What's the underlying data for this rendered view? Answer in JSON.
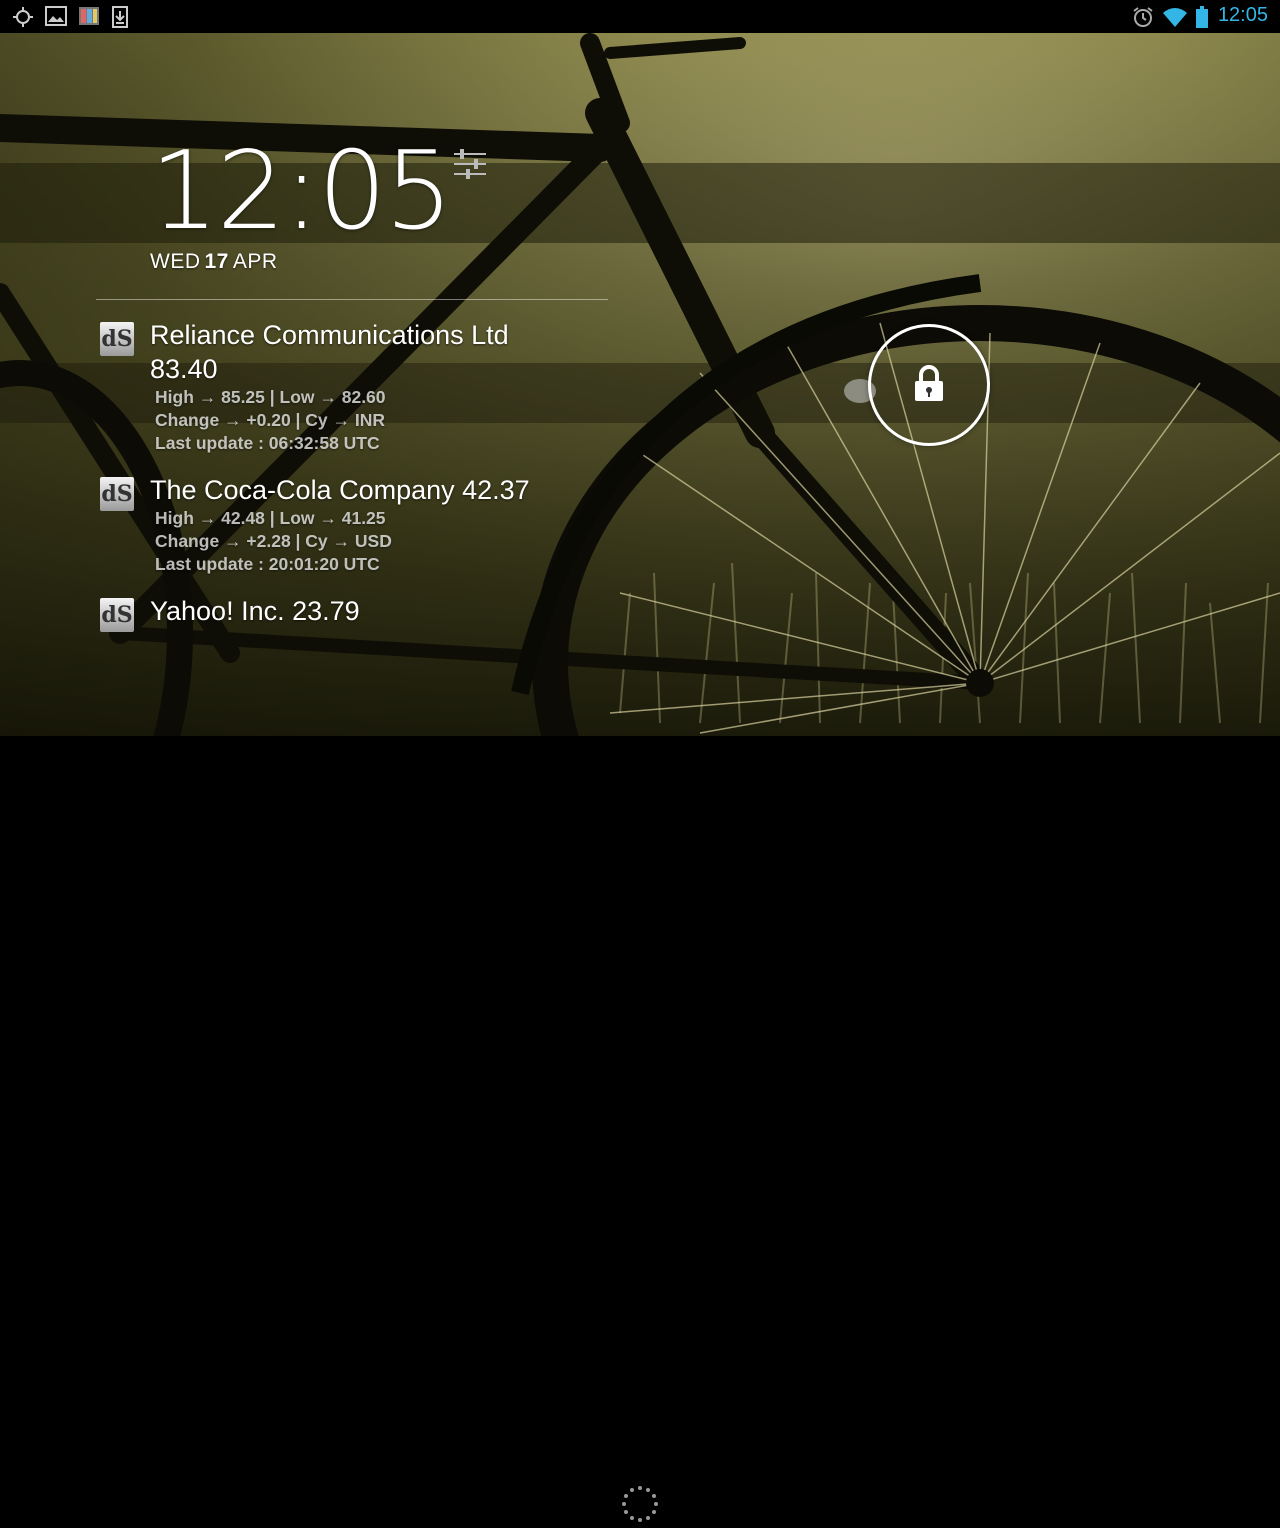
{
  "status_bar": {
    "time": "12:05",
    "left_icons": [
      "gps-icon",
      "image-icon",
      "gallery-icon",
      "download-icon"
    ],
    "right_icons": [
      "alarm-icon",
      "wifi-icon",
      "battery-icon"
    ],
    "accent_color": "#33b5e5"
  },
  "lockscreen": {
    "clock": "12:05",
    "date": {
      "weekday": "WED",
      "day": "17",
      "month": "APR"
    }
  },
  "stocks": [
    {
      "logo": "dS",
      "name_line1": "Reliance Communications Ltd",
      "name_line2": "83.40",
      "details": [
        "High → 85.25 | Low → 82.60",
        "Change → +0.20 | Cy → INR",
        "Last update : 06:32:58 UTC"
      ]
    },
    {
      "logo": "dS",
      "name_line1": "The Coca-Cola Company 42.37",
      "name_line2": "",
      "details": [
        "High → 42.48 | Low → 41.25",
        "Change → +2.28 | Cy → USD",
        "Last update : 20:01:20 UTC"
      ]
    },
    {
      "logo": "dS",
      "name_line1": "Yahoo! Inc. 23.79",
      "name_line2": "",
      "details": []
    }
  ]
}
